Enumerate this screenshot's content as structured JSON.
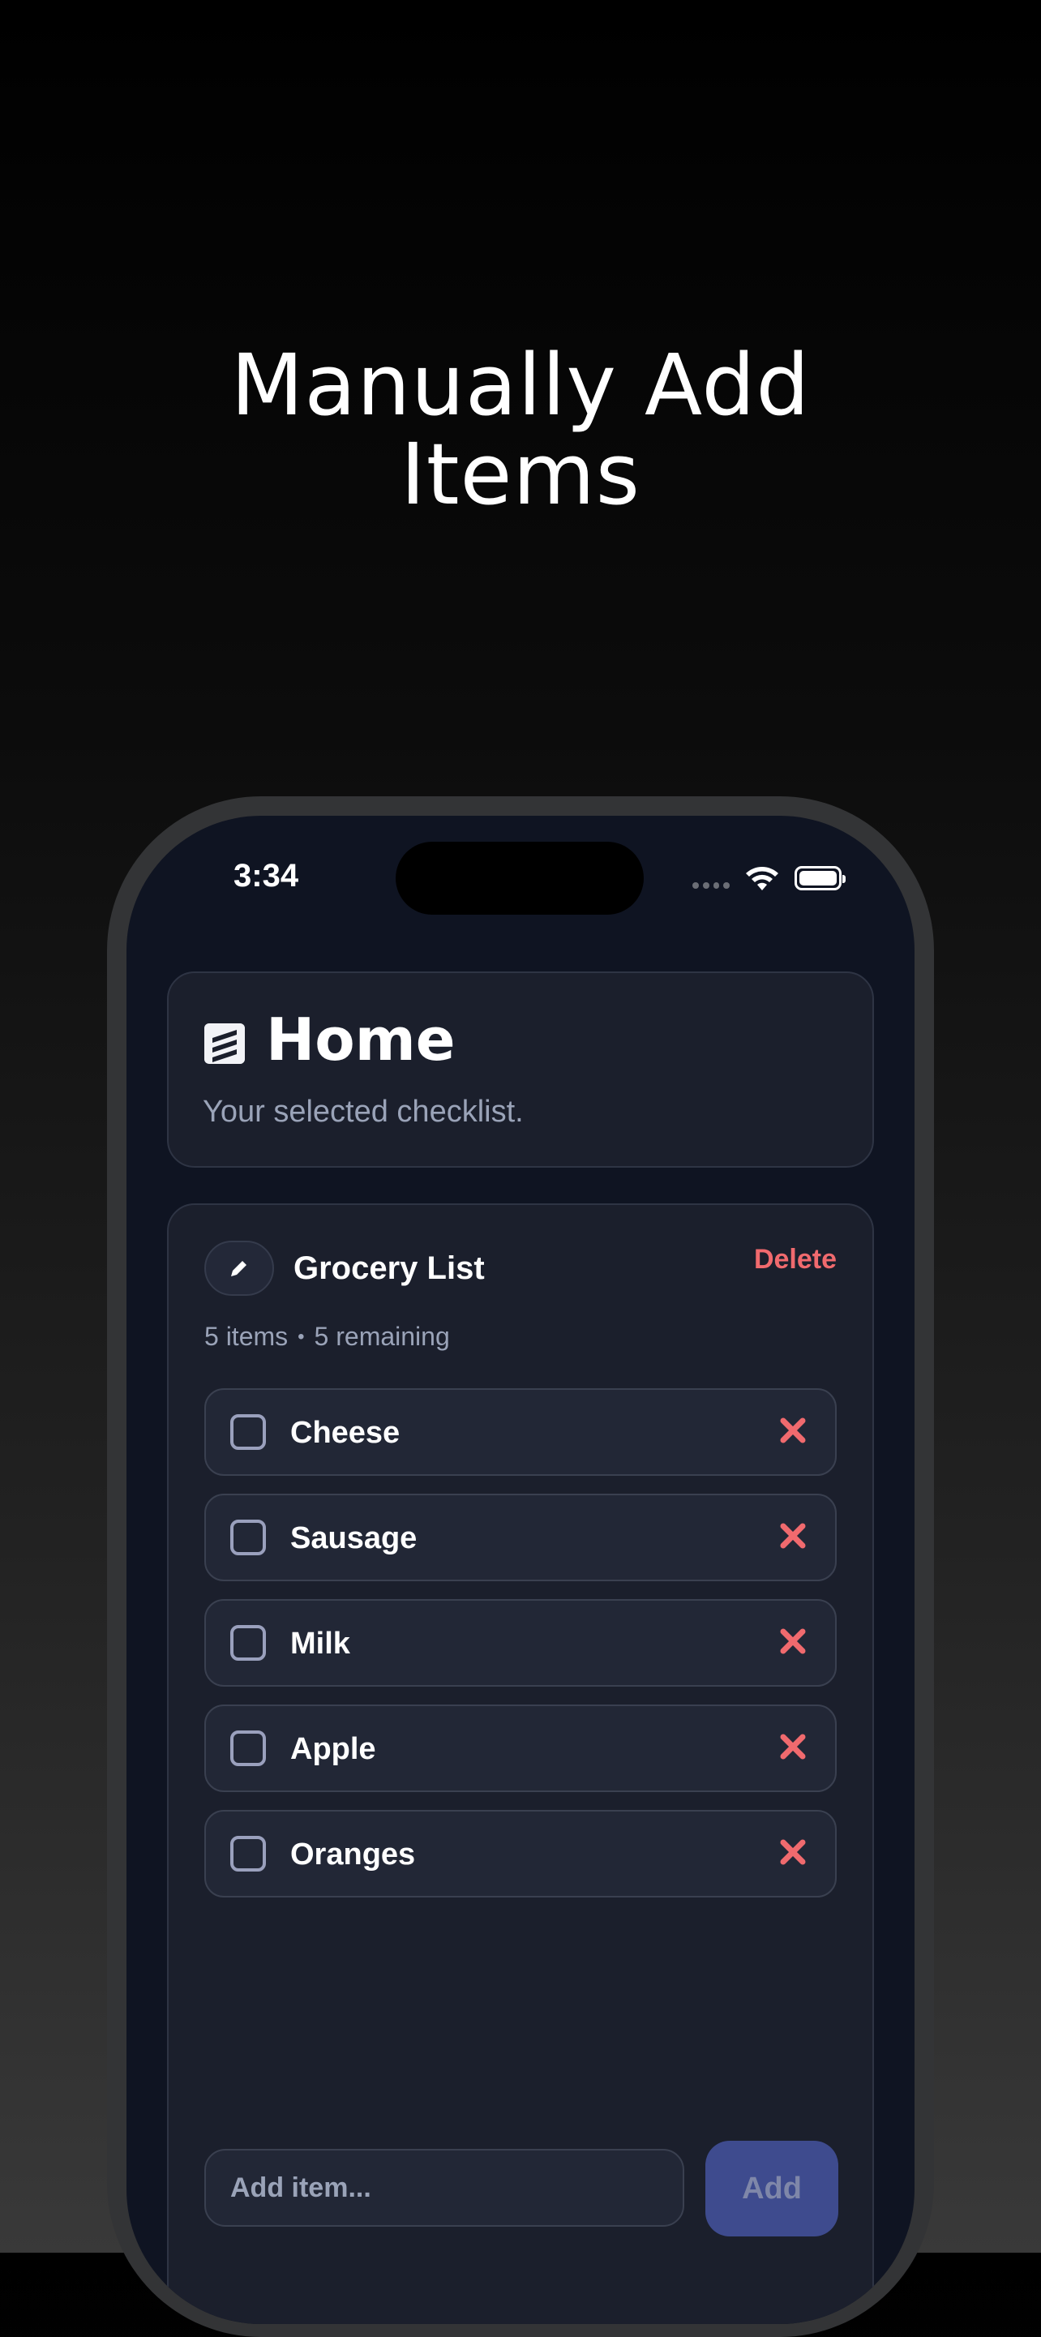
{
  "headline": {
    "line1": "Manually Add",
    "line2": "Items"
  },
  "status_bar": {
    "time": "3:34"
  },
  "home": {
    "title": "Home",
    "subtitle": "Your selected checklist."
  },
  "checklist": {
    "title": "Grocery List",
    "delete_label": "Delete",
    "item_count": "5 items",
    "separator": "•",
    "remaining": "5 remaining",
    "items": [
      {
        "label": "Cheese",
        "checked": false
      },
      {
        "label": "Sausage",
        "checked": false
      },
      {
        "label": "Milk",
        "checked": false
      },
      {
        "label": "Apple",
        "checked": false
      },
      {
        "label": "Oranges",
        "checked": false
      }
    ]
  },
  "add_bar": {
    "placeholder": "Add item...",
    "button_label": "Add"
  },
  "colors": {
    "accent": "#3e4b8e",
    "danger": "#f06a6e",
    "background": "#0f1422"
  },
  "icons": {
    "home": "checklist-stack-icon",
    "edit": "pencil-icon",
    "remove": "x-icon"
  }
}
